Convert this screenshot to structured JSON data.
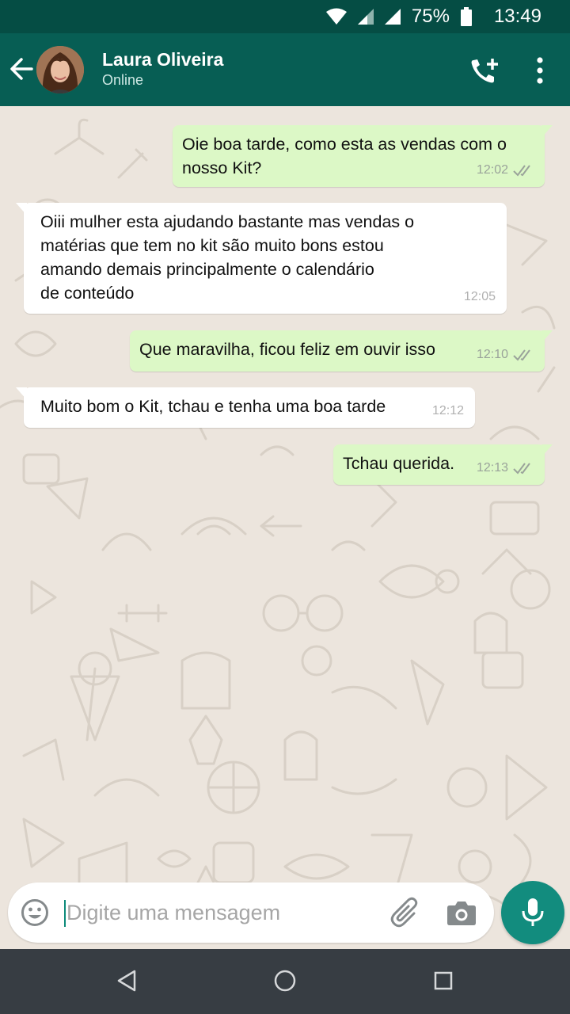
{
  "status_bar": {
    "battery": "75%",
    "time": "13:49"
  },
  "header": {
    "contact_name": "Laura Oliveira",
    "contact_status": "Online"
  },
  "messages": [
    {
      "direction": "out",
      "text": "Oie boa tarde, como esta as vendas com o\nnosso Kit?",
      "time": "12:02",
      "read": true
    },
    {
      "direction": "in",
      "text": "Oiii mulher esta ajudando bastante mas vendas o\nmatérias que tem no kit são muito bons estou\namando demais principalmente o calendário\nde conteúdo",
      "time": "12:05"
    },
    {
      "direction": "out",
      "text": "Que maravilha, ficou feliz em ouvir isso",
      "time": "12:10",
      "read": true
    },
    {
      "direction": "in",
      "text": "Muito bom o Kit, tchau e tenha uma boa tarde",
      "time": "12:12"
    },
    {
      "direction": "out",
      "text": "Tchau querida.",
      "time": "12:13",
      "read": true
    }
  ],
  "composer": {
    "placeholder": "Digite uma mensagem"
  },
  "colors": {
    "header": "#075e54",
    "status_bar": "#054d44",
    "outgoing_bubble": "#dcf8c6",
    "incoming_bubble": "#ffffff",
    "mic_button": "#128c7e",
    "read_ticks": "#9aa39a"
  },
  "icons": {
    "back": "arrow-left-icon",
    "call": "add-call-icon",
    "menu": "more-vert-icon",
    "emoji": "emoji-icon",
    "attach": "paperclip-icon",
    "camera": "camera-icon",
    "mic": "mic-icon"
  }
}
